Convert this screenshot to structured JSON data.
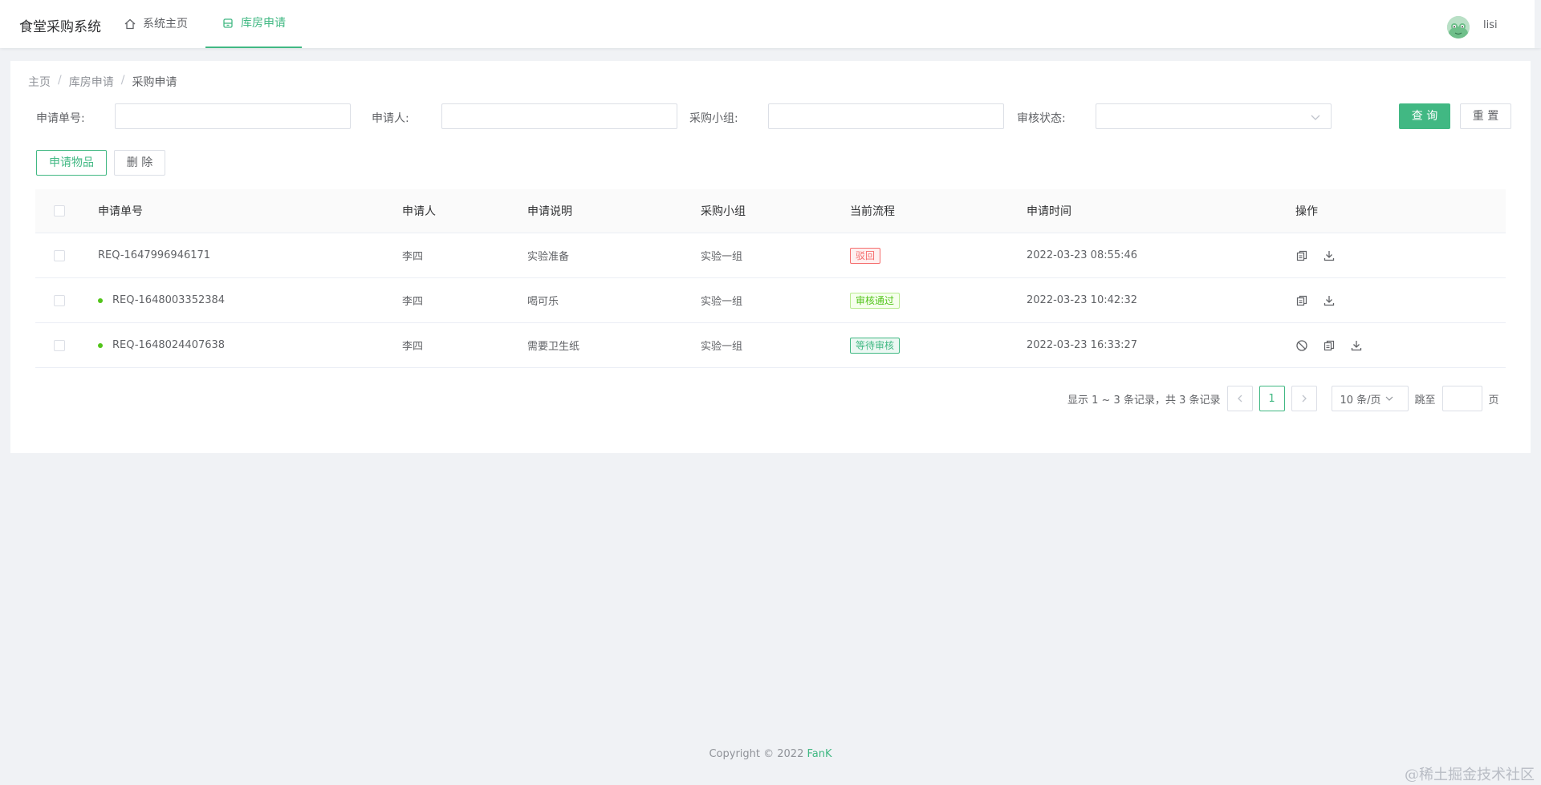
{
  "app": {
    "title": "食堂采购系统",
    "username": "lisi"
  },
  "nav": {
    "home": "系统主页",
    "store": "库房申请"
  },
  "breadcrumb": {
    "home": "主页",
    "store": "库房申请",
    "current": "采购申请",
    "separator": "/"
  },
  "filters": {
    "req_no_label": "申请单号:",
    "applicant_label": "申请人:",
    "group_label": "采购小组:",
    "status_label": "审核状态:",
    "query_button": "查 询",
    "reset_button": "重 置"
  },
  "actions": {
    "apply": "申请物品",
    "delete": "删 除"
  },
  "table": {
    "headers": [
      "申请单号",
      "申请人",
      "申请说明",
      "采购小组",
      "当前流程",
      "申请时间",
      "操作"
    ],
    "rows": [
      {
        "id": "REQ-1647996946171",
        "applicant": "李四",
        "desc": "实验准备",
        "group": "实验一组",
        "status": "驳回",
        "time": "2022-03-23 08:55:46"
      },
      {
        "id": "REQ-1648003352384",
        "applicant": "李四",
        "desc": "喝可乐",
        "group": "实验一组",
        "status": "审核通过",
        "time": "2022-03-23 10:42:32"
      },
      {
        "id": "REQ-1648024407638",
        "applicant": "李四",
        "desc": "需要卫生纸",
        "group": "实验一组",
        "status": "等待审核",
        "time": "2022-03-23 16:33:27"
      }
    ]
  },
  "pagination": {
    "summary": "显示 1 ~ 3 条记录，共 3 条记录",
    "current_page": "1",
    "page_size": "10 条/页",
    "jump_label": "跳至",
    "page_unit": "页"
  },
  "footer": {
    "copyright": "Copyright © 2022 ",
    "author": "FanK"
  },
  "watermark": "@稀土掘金技术社区",
  "colors": {
    "accent": "#41b883",
    "reject": "#f56c6c",
    "approved": "#52c41a",
    "background": "#f0f2f5"
  }
}
